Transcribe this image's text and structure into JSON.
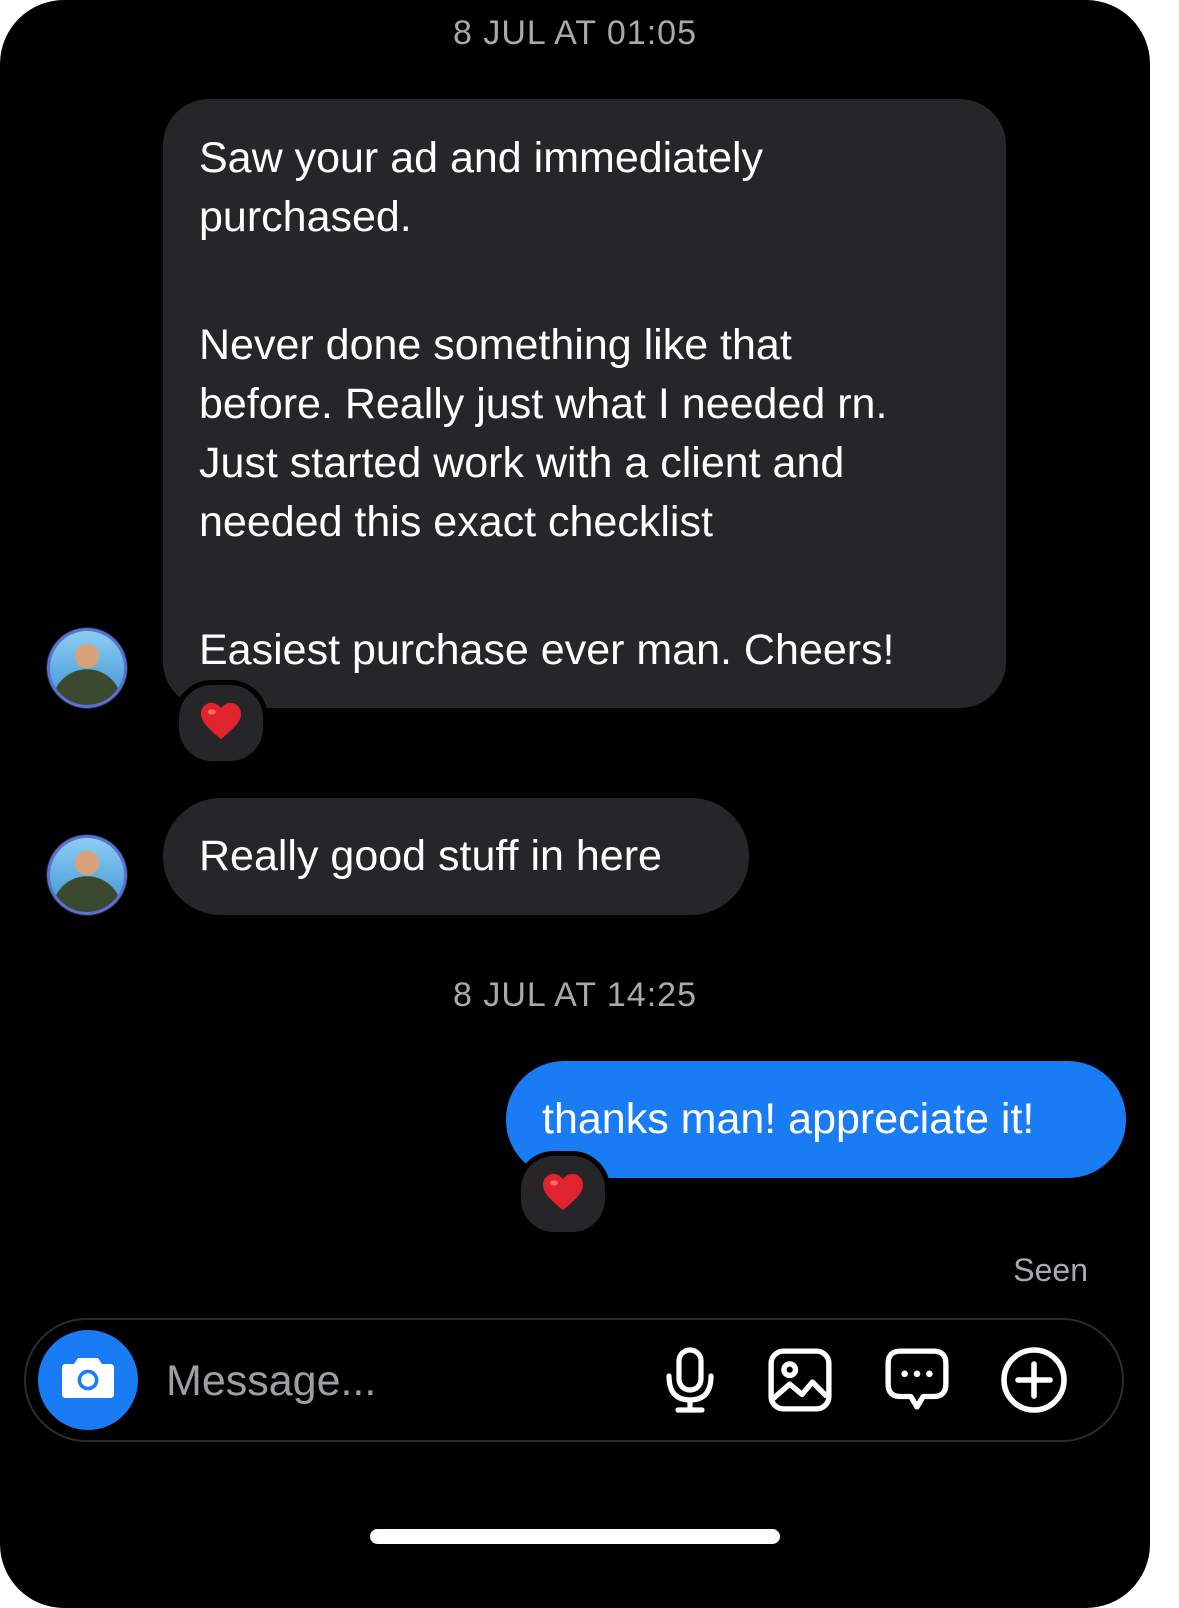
{
  "thread": {
    "timestamp_1": "8 JUL AT 01:05",
    "timestamp_2": "8 JUL AT 14:25",
    "messages": [
      {
        "direction": "incoming",
        "paragraphs": [
          "Saw your ad and immediately\npurchased.",
          "Never done something like that\nbefore. Really just what I needed rn.\nJust started work with a client and\nneeded this exact checklist",
          "Easiest purchase ever man. Cheers!"
        ],
        "reaction": "heart"
      },
      {
        "direction": "incoming",
        "text": "Really good stuff in here"
      },
      {
        "direction": "outgoing",
        "text": "thanks man! appreciate it!",
        "reaction": "heart"
      }
    ],
    "seen_label": "Seen"
  },
  "composer": {
    "placeholder": "Message...",
    "icons": [
      "camera-icon",
      "microphone-icon",
      "image-icon",
      "sticker-chat-icon",
      "plus-circle-icon"
    ]
  },
  "colors": {
    "background": "#000000",
    "incoming_bubble": "#262628",
    "outgoing_bubble": "#1a7cf5",
    "meta_text": "#a8a8ad",
    "heart": "#e0232e"
  }
}
